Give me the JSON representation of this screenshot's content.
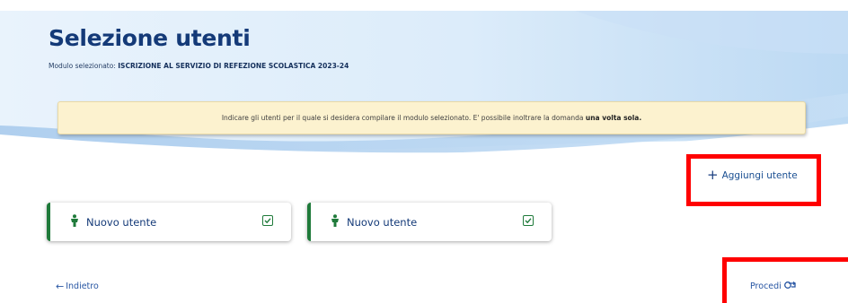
{
  "header": {
    "title": "Selezione utenti",
    "module_label": "Modulo selezionato:",
    "module_value": "ISCRIZIONE AL SERVIZIO DI REFEZIONE SCOLASTICA 2023-24"
  },
  "notice": {
    "text": "Indicare gli utenti per il quale si desidera compilare il modulo selezionato.  E' possibile inoltrare la domanda",
    "emphasis": "una volta sola."
  },
  "actions": {
    "add_user_icon": "+",
    "add_user_label": "Aggiungi utente",
    "back_label": "Indietro",
    "proceed_label": "Procedi"
  },
  "users": [
    {
      "name": "Nuovo utente",
      "icon": "person-icon",
      "status_icon": "checkbox-checked-icon"
    },
    {
      "name": "Nuovo utente",
      "icon": "person-icon",
      "status_icon": "checkbox-checked-icon"
    }
  ],
  "colors": {
    "title": "#143a78",
    "accent_green": "#1f7a3a",
    "notice_bg": "#fcf2cf",
    "link": "#2856a3",
    "highlight_red": "#ff0000"
  }
}
